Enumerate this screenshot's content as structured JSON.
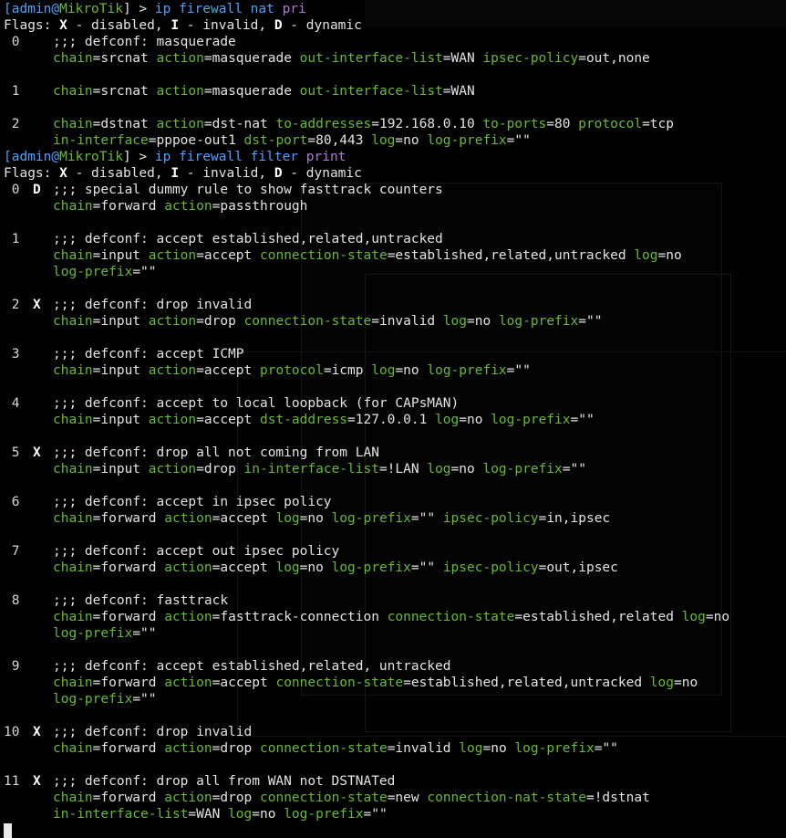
{
  "prompts": [
    {
      "user": "admin",
      "host": "MikroTik",
      "tail": "] > ",
      "cmd": "ip firewall nat ",
      "arg": "pri"
    },
    {
      "user": "admin",
      "host": "MikroTik",
      "tail": "] > ",
      "cmd": "ip firewall filter ",
      "arg": "print"
    }
  ],
  "flags_label": {
    "prefix": "Flags: ",
    "x": "X",
    "x_text": " - disabled, ",
    "i": "I",
    "i_text": " - invalid, ",
    "d": "D",
    "d_text": " - dynamic"
  },
  "nat_rules": [
    {
      "num": " 0",
      "flag": "",
      "lines": [
        [
          {
            "t": ";;; defconf: masquerade"
          }
        ],
        [
          {
            "k": "chain"
          },
          {
            "v": "=srcnat "
          },
          {
            "k": "action"
          },
          {
            "v": "=masquerade "
          },
          {
            "k": "out-interface-list"
          },
          {
            "v": "=WAN "
          },
          {
            "k": "ipsec-policy"
          },
          {
            "v": "=out,none"
          }
        ]
      ]
    },
    {
      "num": " 1",
      "flag": "",
      "lines": [
        [
          {
            "k": "chain"
          },
          {
            "v": "=srcnat "
          },
          {
            "k": "action"
          },
          {
            "v": "=masquerade "
          },
          {
            "k": "out-interface-list"
          },
          {
            "v": "=WAN"
          }
        ]
      ]
    },
    {
      "num": " 2",
      "flag": "",
      "lines": [
        [
          {
            "k": "chain"
          },
          {
            "v": "=dstnat "
          },
          {
            "k": "action"
          },
          {
            "v": "=dst-nat "
          },
          {
            "k": "to-addresses"
          },
          {
            "v": "=192.168.0.10 "
          },
          {
            "k": "to-ports"
          },
          {
            "v": "=80 "
          },
          {
            "k": "protocol"
          },
          {
            "v": "=tcp"
          }
        ],
        [
          {
            "k": "in-interface"
          },
          {
            "v": "=pppoe-out1 "
          },
          {
            "k": "dst-port"
          },
          {
            "v": "=80,443 "
          },
          {
            "k": "log"
          },
          {
            "v": "=no "
          },
          {
            "k": "log-prefix"
          },
          {
            "v": "=\"\""
          }
        ]
      ]
    }
  ],
  "filter_rules": [
    {
      "num": " 0",
      "flag": "D",
      "lines": [
        [
          {
            "t": ";;; special dummy rule to show fasttrack counters"
          }
        ],
        [
          {
            "k": "chain"
          },
          {
            "v": "=forward "
          },
          {
            "k": "action"
          },
          {
            "v": "=passthrough"
          }
        ]
      ]
    },
    {
      "num": " 1",
      "flag": "",
      "lines": [
        [
          {
            "t": ";;; defconf: accept established,related,untracked"
          }
        ],
        [
          {
            "k": "chain"
          },
          {
            "v": "=input "
          },
          {
            "k": "action"
          },
          {
            "v": "=accept "
          },
          {
            "k": "connection-state"
          },
          {
            "v": "=established,related,untracked "
          },
          {
            "k": "log"
          },
          {
            "v": "=no"
          }
        ],
        [
          {
            "k": "log-prefix"
          },
          {
            "v": "=\"\""
          }
        ]
      ]
    },
    {
      "num": " 2",
      "flag": "X",
      "lines": [
        [
          {
            "t": ";;; defconf: drop invalid"
          }
        ],
        [
          {
            "k": "chain"
          },
          {
            "v": "=input "
          },
          {
            "k": "action"
          },
          {
            "v": "=drop "
          },
          {
            "k": "connection-state"
          },
          {
            "v": "=invalid "
          },
          {
            "k": "log"
          },
          {
            "v": "=no "
          },
          {
            "k": "log-prefix"
          },
          {
            "v": "=\"\""
          }
        ]
      ]
    },
    {
      "num": " 3",
      "flag": "",
      "lines": [
        [
          {
            "t": ";;; defconf: accept ICMP"
          }
        ],
        [
          {
            "k": "chain"
          },
          {
            "v": "=input "
          },
          {
            "k": "action"
          },
          {
            "v": "=accept "
          },
          {
            "k": "protocol"
          },
          {
            "v": "=icmp "
          },
          {
            "k": "log"
          },
          {
            "v": "=no "
          },
          {
            "k": "log-prefix"
          },
          {
            "v": "=\"\""
          }
        ]
      ]
    },
    {
      "num": " 4",
      "flag": "",
      "lines": [
        [
          {
            "t": ";;; defconf: accept to local loopback (for CAPsMAN)"
          }
        ],
        [
          {
            "k": "chain"
          },
          {
            "v": "=input "
          },
          {
            "k": "action"
          },
          {
            "v": "=accept "
          },
          {
            "k": "dst-address"
          },
          {
            "v": "=127.0.0.1 "
          },
          {
            "k": "log"
          },
          {
            "v": "=no "
          },
          {
            "k": "log-prefix"
          },
          {
            "v": "=\"\""
          }
        ]
      ]
    },
    {
      "num": " 5",
      "flag": "X",
      "lines": [
        [
          {
            "t": ";;; defconf: drop all not coming from LAN"
          }
        ],
        [
          {
            "k": "chain"
          },
          {
            "v": "=input "
          },
          {
            "k": "action"
          },
          {
            "v": "=drop "
          },
          {
            "k": "in-interface-list"
          },
          {
            "v": "=!LAN "
          },
          {
            "k": "log"
          },
          {
            "v": "=no "
          },
          {
            "k": "log-prefix"
          },
          {
            "v": "=\"\""
          }
        ]
      ]
    },
    {
      "num": " 6",
      "flag": "",
      "lines": [
        [
          {
            "t": ";;; defconf: accept in ipsec policy"
          }
        ],
        [
          {
            "k": "chain"
          },
          {
            "v": "=forward "
          },
          {
            "k": "action"
          },
          {
            "v": "=accept "
          },
          {
            "k": "log"
          },
          {
            "v": "=no "
          },
          {
            "k": "log-prefix"
          },
          {
            "v": "=\"\" "
          },
          {
            "k": "ipsec-policy"
          },
          {
            "v": "=in,ipsec"
          }
        ]
      ]
    },
    {
      "num": " 7",
      "flag": "",
      "lines": [
        [
          {
            "t": ";;; defconf: accept out ipsec policy"
          }
        ],
        [
          {
            "k": "chain"
          },
          {
            "v": "=forward "
          },
          {
            "k": "action"
          },
          {
            "v": "=accept "
          },
          {
            "k": "log"
          },
          {
            "v": "=no "
          },
          {
            "k": "log-prefix"
          },
          {
            "v": "=\"\" "
          },
          {
            "k": "ipsec-policy"
          },
          {
            "v": "=out,ipsec"
          }
        ]
      ]
    },
    {
      "num": " 8",
      "flag": "",
      "lines": [
        [
          {
            "t": ";;; defconf: fasttrack"
          }
        ],
        [
          {
            "k": "chain"
          },
          {
            "v": "=forward "
          },
          {
            "k": "action"
          },
          {
            "v": "=fasttrack-connection "
          },
          {
            "k": "connection-state"
          },
          {
            "v": "=established,related "
          },
          {
            "k": "log"
          },
          {
            "v": "=no"
          }
        ],
        [
          {
            "k": "log-prefix"
          },
          {
            "v": "=\"\""
          }
        ]
      ]
    },
    {
      "num": " 9",
      "flag": "",
      "lines": [
        [
          {
            "t": ";;; defconf: accept established,related, untracked"
          }
        ],
        [
          {
            "k": "chain"
          },
          {
            "v": "=forward "
          },
          {
            "k": "action"
          },
          {
            "v": "=accept "
          },
          {
            "k": "connection-state"
          },
          {
            "v": "=established,related,untracked "
          },
          {
            "k": "log"
          },
          {
            "v": "=no"
          }
        ],
        [
          {
            "k": "log-prefix"
          },
          {
            "v": "=\"\""
          }
        ]
      ]
    },
    {
      "num": "10",
      "flag": "X",
      "lines": [
        [
          {
            "t": ";;; defconf: drop invalid"
          }
        ],
        [
          {
            "k": "chain"
          },
          {
            "v": "=forward "
          },
          {
            "k": "action"
          },
          {
            "v": "=drop "
          },
          {
            "k": "connection-state"
          },
          {
            "v": "=invalid "
          },
          {
            "k": "log"
          },
          {
            "v": "=no "
          },
          {
            "k": "log-prefix"
          },
          {
            "v": "=\"\""
          }
        ]
      ]
    },
    {
      "num": "11",
      "flag": "X",
      "lines": [
        [
          {
            "t": ";;; defconf: drop all from WAN not DSTNATed"
          }
        ],
        [
          {
            "k": "chain"
          },
          {
            "v": "=forward "
          },
          {
            "k": "action"
          },
          {
            "v": "=drop "
          },
          {
            "k": "connection-state"
          },
          {
            "v": "=new "
          },
          {
            "k": "connection-nat-state"
          },
          {
            "v": "=!dstnat"
          }
        ],
        [
          {
            "k": "in-interface-list"
          },
          {
            "v": "=WAN "
          },
          {
            "k": "log"
          },
          {
            "v": "=no "
          },
          {
            "k": "log-prefix"
          },
          {
            "v": "=\"\""
          }
        ]
      ]
    }
  ],
  "colors": {
    "background": "#000000",
    "key": "#66bb33",
    "value": "#e4e4e4",
    "prompt": "#4ea1ff",
    "argument": "#b078d8"
  }
}
